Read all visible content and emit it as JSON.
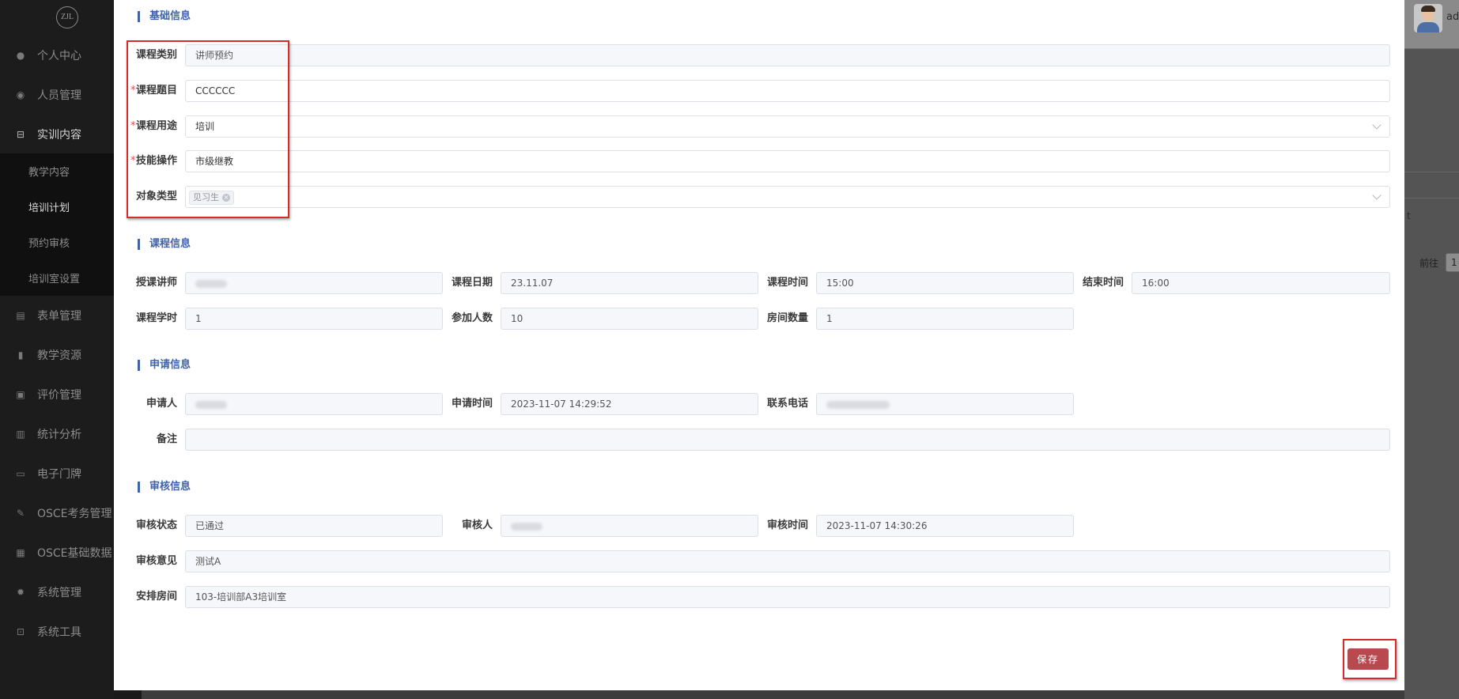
{
  "sidebar": {
    "logo": "ZJL",
    "items": [
      {
        "label": "个人中心",
        "icon": "user-icon"
      },
      {
        "label": "人员管理",
        "icon": "users-icon"
      },
      {
        "label": "实训内容",
        "icon": "tree-icon"
      },
      {
        "label": "表单管理",
        "icon": "form-icon"
      },
      {
        "label": "教学资源",
        "icon": "book-icon"
      },
      {
        "label": "评价管理",
        "icon": "rating-icon"
      },
      {
        "label": "统计分析",
        "icon": "bar-chart-icon"
      },
      {
        "label": "电子门牌",
        "icon": "monitor-icon"
      },
      {
        "label": "OSCE考务管理",
        "icon": "edit-icon"
      },
      {
        "label": "OSCE基础数据",
        "icon": "grid-icon"
      },
      {
        "label": "系统管理",
        "icon": "gear-icon"
      },
      {
        "label": "系统工具",
        "icon": "toolbox-icon"
      }
    ],
    "submenu": [
      "教学内容",
      "培训计划",
      "预约审核",
      "培训室设置"
    ]
  },
  "header": {
    "username": "adi"
  },
  "background": {
    "goto_label": "前往",
    "page_value": "1",
    "fragment": "t"
  },
  "dialog": {
    "basic": {
      "title": "基础信息",
      "course_type_label": "课程类别",
      "course_type_value": "讲师预约",
      "course_title_label": "课程题目",
      "course_title_value": "CCCCCC",
      "course_use_label": "课程用途",
      "course_use_value": "培训",
      "skill_label": "技能操作",
      "skill_value": "市级继教",
      "target_label": "对象类型",
      "target_tag": "见习生"
    },
    "course": {
      "title": "课程信息",
      "teacher_label": "授课讲师",
      "date_label": "课程日期",
      "date_value": "23.11.07",
      "time_label": "课程时间",
      "time_value": "15:00",
      "end_label": "结束时间",
      "end_value": "16:00",
      "hours_label": "课程学时",
      "hours_value": "1",
      "people_label": "参加人数",
      "people_value": "10",
      "rooms_label": "房间数量",
      "rooms_value": "1"
    },
    "apply": {
      "title": "申请信息",
      "applicant_label": "申请人",
      "apply_time_label": "申请时间",
      "apply_time_value": "2023-11-07 14:29:52",
      "phone_label": "联系电话",
      "remark_label": "备注"
    },
    "review": {
      "title": "审核信息",
      "status_label": "审核状态",
      "status_value": "已通过",
      "reviewer_label": "审核人",
      "review_time_label": "审核时间",
      "review_time_value": "2023-11-07 14:30:26",
      "opinion_label": "审核意见",
      "opinion_value": "测试A",
      "room_label": "安排房间",
      "room_value": "103-培训部A3培训室"
    },
    "save_label": "保存"
  },
  "colors": {
    "accent": "#3f63a8",
    "save_button": "#b8494f",
    "highlight_box": "#d52b2b",
    "sidebar_bg": "#1c1c1c"
  }
}
